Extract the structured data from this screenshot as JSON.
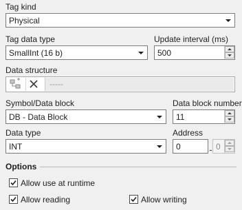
{
  "tag_kind": {
    "label": "Tag kind",
    "value": "Physical"
  },
  "tag_data_type": {
    "label": "Tag data type",
    "value": "SmallInt (16 b)"
  },
  "update_interval": {
    "label": "Update interval (ms)",
    "value": "500"
  },
  "data_structure": {
    "label": "Data structure",
    "value": "-----",
    "add_icon": "structure-add-icon",
    "remove_icon": "close-icon"
  },
  "symbol_data_block": {
    "label": "Symbol/Data block",
    "value": "DB - Data Block"
  },
  "data_block_number": {
    "label": "Data block number",
    "value": "11"
  },
  "data_type": {
    "label": "Data type",
    "value": "INT"
  },
  "address": {
    "label": "Address",
    "value": "0",
    "bit_value": "0"
  },
  "options": {
    "title": "Options",
    "allow_runtime": {
      "label": "Allow use at runtime",
      "checked": true
    },
    "allow_reading": {
      "label": "Allow reading",
      "checked": true
    },
    "allow_writing": {
      "label": "Allow writing",
      "checked": true
    }
  },
  "colors": {
    "background": "#f0f0f0",
    "border": "#7a7a7a",
    "check": "#1e1e1e"
  }
}
